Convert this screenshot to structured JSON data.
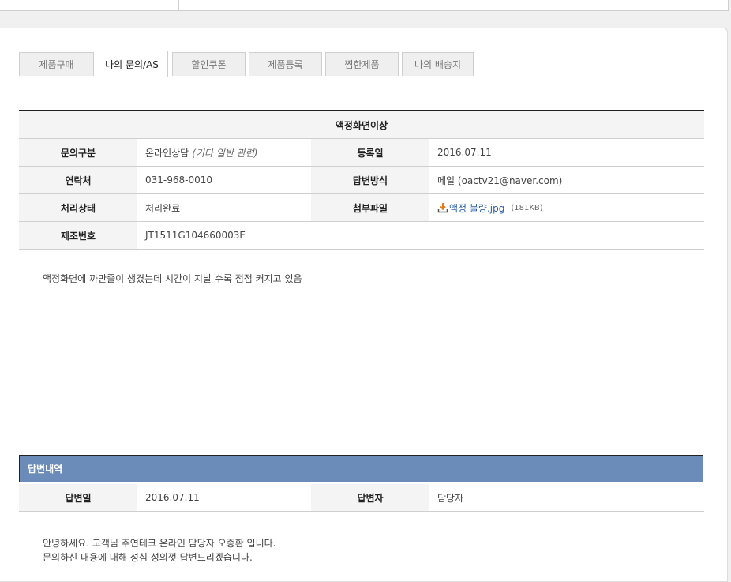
{
  "tabs": [
    {
      "label": "제품구매"
    },
    {
      "label": "나의 문의/AS"
    },
    {
      "label": "할인쿠폰"
    },
    {
      "label": "제품등록"
    },
    {
      "label": "찜한제품"
    },
    {
      "label": "나의 배송지"
    }
  ],
  "active_tab": "나의 문의/AS",
  "inquiry": {
    "title": "액정화면이상",
    "labels": {
      "category": "문의구분",
      "registered": "등록일",
      "contact": "연락처",
      "reply_method": "답변방식",
      "status": "처리상태",
      "attachment": "첨부파일",
      "serial": "제조번호"
    },
    "category_value": "온라인상담",
    "category_sub": "(기타 일반 관련)",
    "registered_value": "2016.07.11",
    "contact_value": "031-968-0010",
    "reply_method_value": "메일 (oactv21@naver.com)",
    "status_value": "처리완료",
    "attachment_name": "액정 불량.jpg",
    "attachment_size": "(181KB)",
    "serial_value": "JT1511G104660003E",
    "body": "액정화면에 까만줄이 생겼는데 시간이 지날 수록 점점 커지고 있음"
  },
  "answer": {
    "header": "답변내역",
    "labels": {
      "date": "답변일",
      "author": "답변자"
    },
    "date_value": "2016.07.11",
    "author_value": "담당자",
    "body_lines": [
      "안녕하세요. 고객님 주연테크 온라인 담당자 오종환 입니다.",
      "문의하신 내용에 대해 성심 성의껏 답변드리겠습니다."
    ]
  },
  "colors": {
    "answer_header_bg": "#6b8cb8",
    "link": "#2a5da8",
    "download_icon": "#e07b1a"
  },
  "icons": {
    "attachment": "download-icon"
  }
}
